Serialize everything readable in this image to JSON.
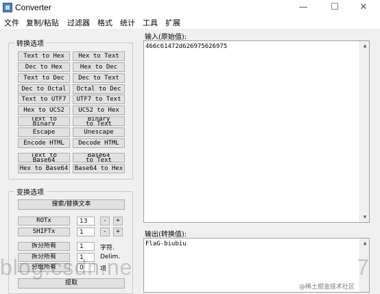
{
  "window": {
    "title": "Converter",
    "controls": {
      "minimize": "—",
      "maximize": "☐",
      "close": "✕"
    }
  },
  "menu": {
    "items": [
      "文件",
      "复制/粘贴",
      "过滤器",
      "格式",
      "统计",
      "工具",
      "扩展"
    ]
  },
  "conversion_options": {
    "title": "转换选项",
    "buttons": [
      [
        "Text to Hex",
        "Hex to Text"
      ],
      [
        "Dec to Hex",
        "Hex to Dec"
      ],
      [
        "Text to Dec",
        "Dec to Text"
      ],
      [
        "Dec to Octal",
        "Octal to Dec"
      ],
      [
        "Text to UTF7",
        "UTF7 to Text"
      ],
      [
        "Hex to UCS2",
        "UCS2 to Hex"
      ],
      [
        "Text to Binary",
        "Binary to Text"
      ],
      [
        "Escape",
        "Unescape"
      ],
      [
        "Encode HTML",
        "Decode HTML"
      ],
      [
        "Text to Base64",
        "Base64 to Text"
      ],
      [
        "Hex to Base64",
        "Base64 to Hex"
      ]
    ]
  },
  "transform_options": {
    "title": "变换选项",
    "search_replace": "搜索/替换文本",
    "rot": {
      "label": "ROTx",
      "value": "13",
      "minus": "-",
      "plus": "+"
    },
    "shift": {
      "label": "SHIFTx",
      "value": "1",
      "minus": "-",
      "plus": "+"
    },
    "split_chars": {
      "label": "拆分所有",
      "value": "1",
      "unit": "字符."
    },
    "split_delim": {
      "label": "拆分所有",
      "value": "1",
      "unit": "Delim."
    },
    "group_all": {
      "label": "分组所有",
      "value": "0",
      "unit": "项"
    },
    "extract": "提取"
  },
  "input": {
    "label": "输入(原始值):",
    "value": "466c61472d626975626975"
  },
  "output": {
    "label": "输出(转换值):",
    "value": "FlaG-biubiu"
  },
  "scrollbar": {
    "up": "▲",
    "down": "▼"
  },
  "watermark": {
    "text": "blog.csdn.ne",
    "tail": "7"
  },
  "credit": "@稀土掘金技术社区"
}
